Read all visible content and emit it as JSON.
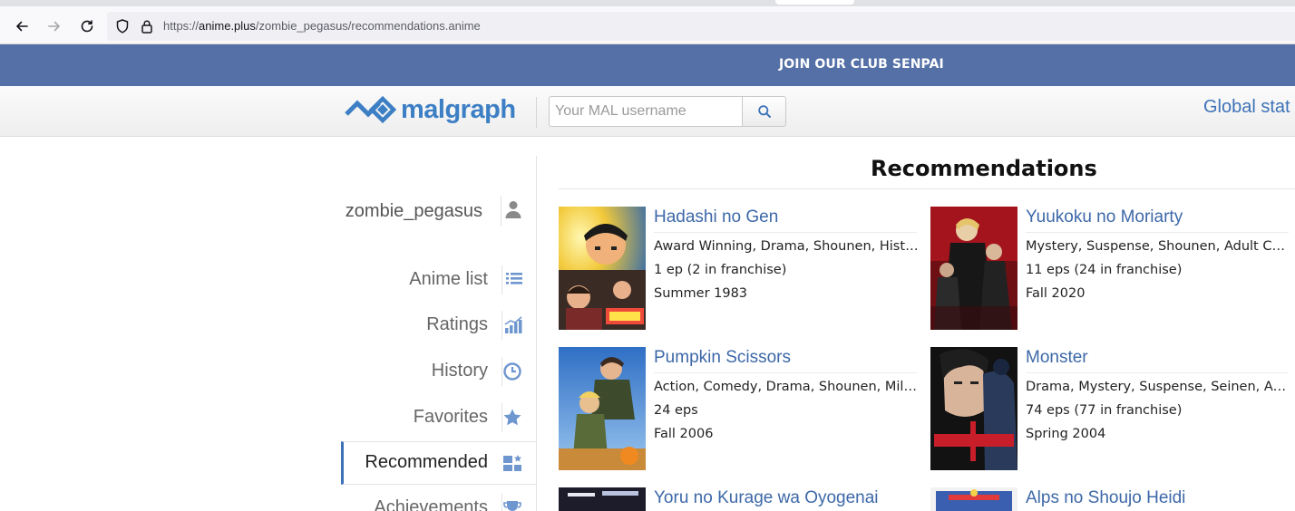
{
  "browser": {
    "url_prefix": "https://",
    "url_domain": "anime.plus",
    "url_path": "/zombie_pegasus/recommendations.anime"
  },
  "banner": {
    "text": "JOIN OUR CLUB SENPAI"
  },
  "header": {
    "logo_text": "malgraph",
    "search_placeholder": "Your MAL username",
    "global_stats_label": "Global stat"
  },
  "sidebar": {
    "username": "zombie_pegasus",
    "items": [
      {
        "label": "Anime list",
        "icon": "list-icon"
      },
      {
        "label": "Ratings",
        "icon": "bar-chart-icon"
      },
      {
        "label": "History",
        "icon": "history-icon"
      },
      {
        "label": "Favorites",
        "icon": "star-icon"
      },
      {
        "label": "Recommended",
        "icon": "recommend-icon",
        "active": true
      },
      {
        "label": "Achievements",
        "icon": "trophy-icon"
      }
    ]
  },
  "main": {
    "title": "Recommendations",
    "recommendations": [
      {
        "title": "Hadashi no Gen",
        "genres": "Award Winning, Drama, Shounen, Historical",
        "episodes": "1 ep (2 in franchise)",
        "season": "Summer 1983"
      },
      {
        "title": "Yuukoku no Moriarty",
        "genres": "Mystery, Suspense, Shounen, Adult Cast",
        "episodes": "11 eps (24 in franchise)",
        "season": "Fall 2020"
      },
      {
        "title": "Pumpkin Scissors",
        "genres": "Action, Comedy, Drama, Shounen, Military",
        "episodes": "24 eps",
        "season": "Fall 2006"
      },
      {
        "title": "Monster",
        "genres": "Drama, Mystery, Suspense, Seinen, Adult Cast",
        "episodes": "74 eps (77 in franchise)",
        "season": "Spring 2004"
      },
      {
        "title": "Yoru no Kurage wa Oyogenai",
        "genres": "",
        "episodes": "",
        "season": ""
      },
      {
        "title": "Alps no Shoujo Heidi",
        "genres": "",
        "episodes": "",
        "season": ""
      }
    ]
  },
  "colors": {
    "banner": "#5470a6",
    "link": "#3d68a8",
    "logo": "#3d7fc4",
    "active_marker": "#3d72b8"
  }
}
